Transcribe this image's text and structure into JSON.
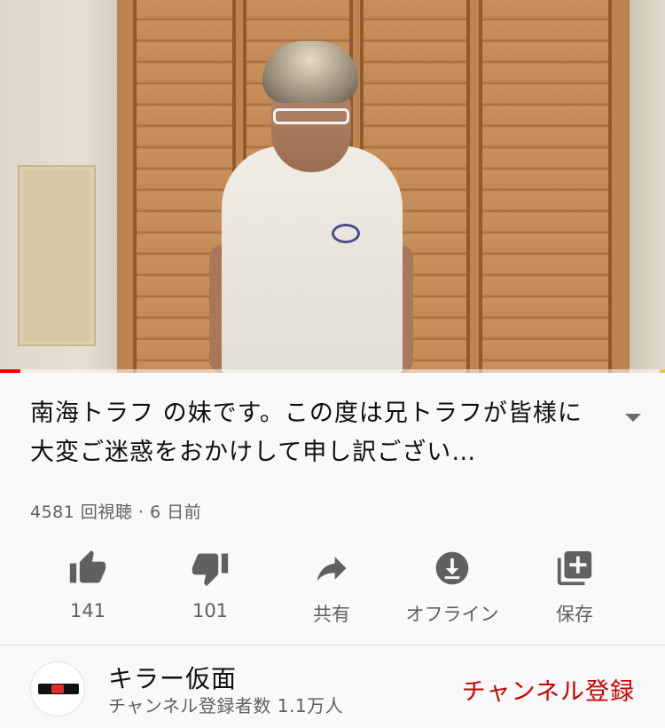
{
  "video": {
    "progress_fraction": 0.03
  },
  "info": {
    "title": "南海トラフ の妹です。この度は兄トラフが皆様に大変ご迷惑をおかけして申し訳ござい…",
    "views": "4581 回視聴",
    "separator": " · ",
    "age": "6 日前"
  },
  "actions": {
    "like": {
      "label": "141",
      "icon": "thumbs-up-icon"
    },
    "dislike": {
      "label": "101",
      "icon": "thumbs-down-icon"
    },
    "share": {
      "label": "共有",
      "icon": "share-arrow-icon"
    },
    "offline": {
      "label": "オフライン",
      "icon": "download-icon"
    },
    "save": {
      "label": "保存",
      "icon": "add-to-playlist-icon"
    }
  },
  "channel": {
    "name": "キラー仮面",
    "subscribers": "チャンネル登録者数 1.1万人",
    "subscribe_label": "チャンネル登録"
  },
  "colors": {
    "accent_red": "#cc0000",
    "progress_red": "#ff0000",
    "icon_gray": "#606060"
  }
}
